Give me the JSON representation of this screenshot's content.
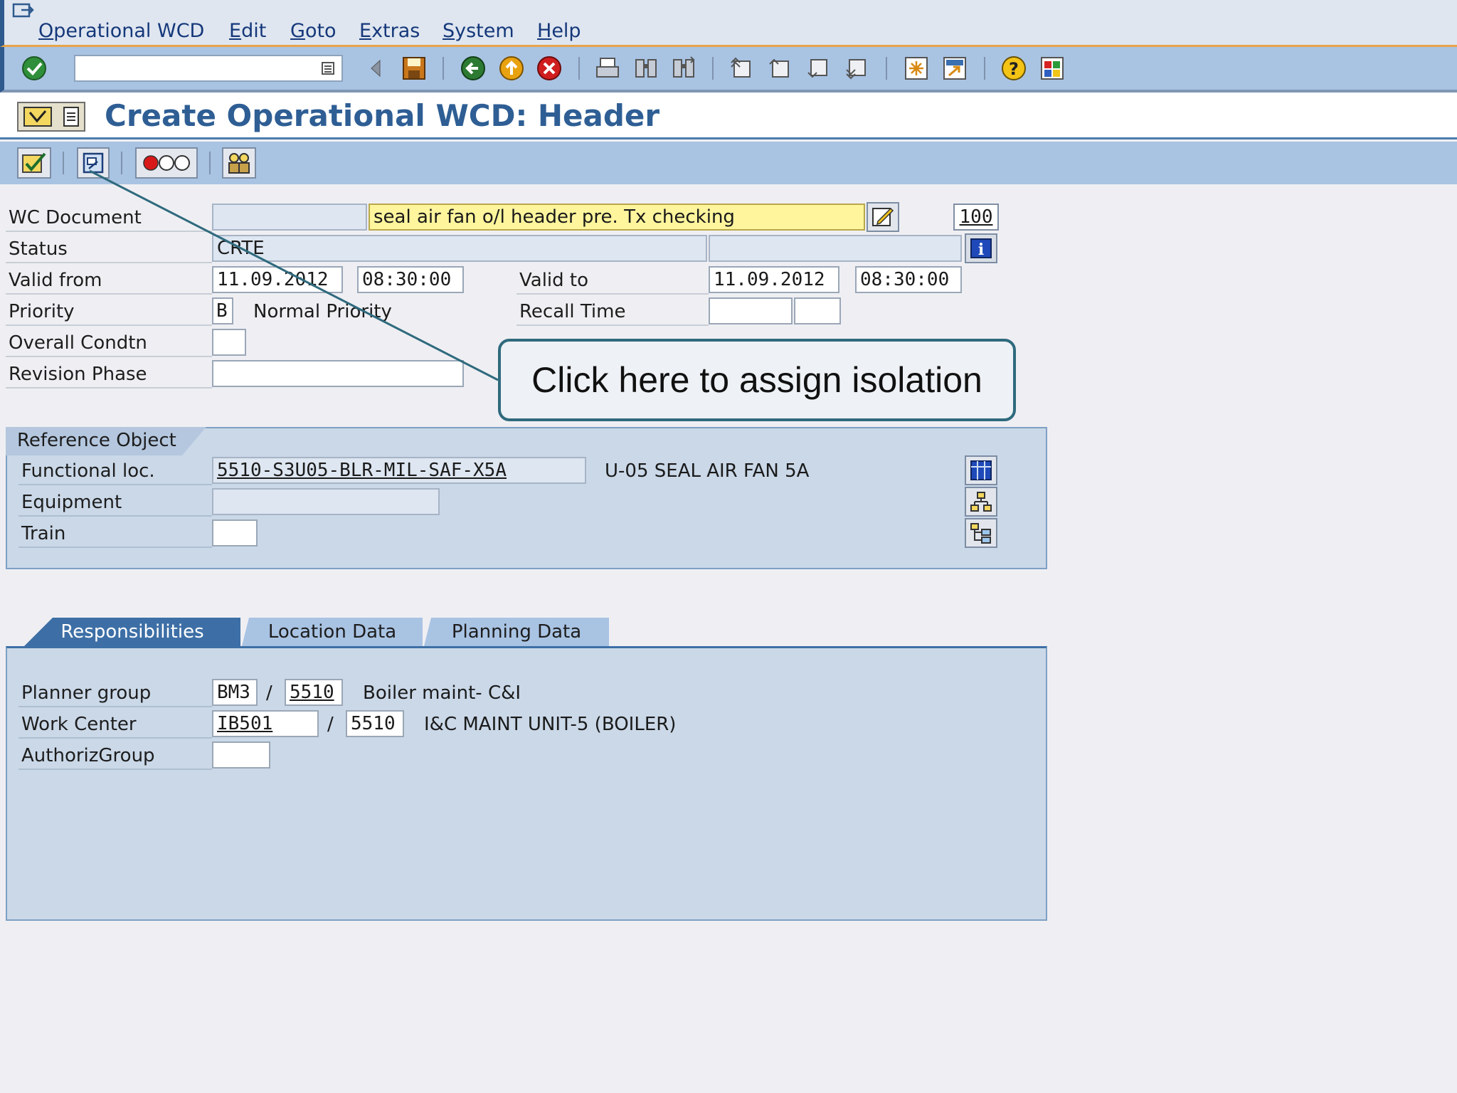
{
  "menu": [
    "Operational WCD",
    "Edit",
    "Goto",
    "Extras",
    "System",
    "Help"
  ],
  "page_title": "Create Operational WCD: Header",
  "form": {
    "wc_document": {
      "label": "WC Document",
      "number": "",
      "description": "seal air fan o/l header pre. Tx checking",
      "code": "100"
    },
    "status": {
      "label": "Status",
      "value": "CRTE",
      "value2": ""
    },
    "valid_from": {
      "label": "Valid from",
      "date": "11.09.2012",
      "time": "08:30:00"
    },
    "valid_to": {
      "label": "Valid to",
      "date": "11.09.2012",
      "time": "08:30:00"
    },
    "priority": {
      "label": "Priority",
      "code": "B",
      "text": "Normal Priority"
    },
    "recall_time": {
      "label": "Recall Time",
      "value1": "",
      "value2": ""
    },
    "overall_condtn": {
      "label": "Overall Condtn",
      "value": ""
    },
    "revision_phase": {
      "label": "Revision Phase",
      "value": ""
    }
  },
  "reference_object": {
    "title": "Reference Object",
    "functional_loc": {
      "label": "Functional loc.",
      "value": "5510-S3U05-BLR-MIL-SAF-X5A",
      "description": "U-05 SEAL AIR FAN 5A"
    },
    "equipment": {
      "label": "Equipment",
      "value": ""
    },
    "train": {
      "label": "Train",
      "value": ""
    }
  },
  "tabs": [
    "Responsibilities",
    "Location Data",
    "Planning Data"
  ],
  "responsibilities": {
    "planner_group": {
      "label": "Planner group",
      "code": "BM3",
      "plant": "5510",
      "text": "Boiler maint- C&I"
    },
    "work_center": {
      "label": "Work Center",
      "code": "IB501",
      "plant": "5510",
      "text": "I&C MAINT UNIT-5 (BOILER)"
    },
    "authoriz_group": {
      "label": "AuthorizGroup",
      "value": ""
    }
  },
  "separator": "/",
  "callout": "Click here to assign isolation",
  "colors": {
    "title": "#2e5e94",
    "toolbar": "#a9c3e3",
    "panel": "#cad8e8",
    "highlight_field": "#fff59d",
    "callout_border": "#2f6a7d"
  }
}
